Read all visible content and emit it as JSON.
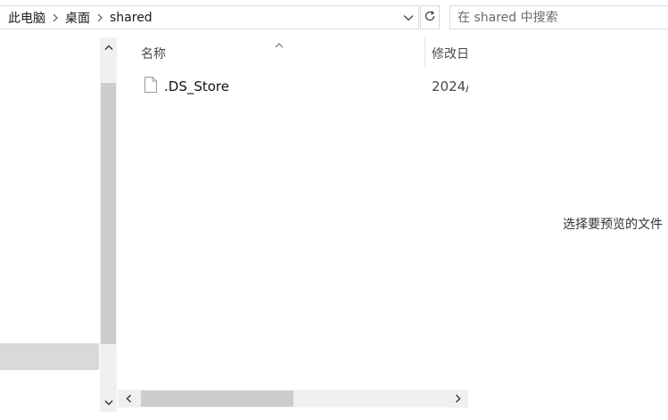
{
  "breadcrumb": {
    "items": [
      "此电脑",
      "桌面",
      "shared"
    ]
  },
  "search": {
    "placeholder": "在 shared 中搜索"
  },
  "file_list": {
    "columns": {
      "name": "名称",
      "date_modified": "修改日"
    },
    "files": [
      {
        "name": ".DS_Store",
        "date": "2024/"
      }
    ]
  },
  "preview": {
    "message": "选择要预览的文件"
  },
  "icons": {
    "breadcrumb_separator": "chevron-right-icon",
    "address_dropdown": "chevron-down-icon",
    "refresh": "refresh-icon",
    "sort": "sort-ascending-icon",
    "file": "file-icon",
    "scroll_up": "scroll-up-icon",
    "scroll_down": "scroll-down-icon",
    "scroll_left": "scroll-left-icon",
    "scroll_right": "scroll-right-icon"
  },
  "colors": {
    "border": "#d9d9d9",
    "scrollbar_track": "#f0f0f0",
    "scrollbar_thumb": "#cdcdcd",
    "nav_selection": "#d9d9d9"
  }
}
